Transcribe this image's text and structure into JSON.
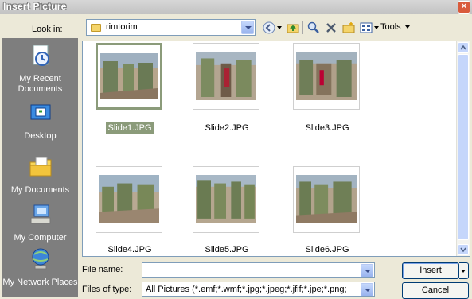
{
  "window": {
    "title": "Insert Picture",
    "close_glyph": "×"
  },
  "toolbar": {
    "look_in_label": "Look in:",
    "look_in_value": "rimtorim",
    "tools_label": "Tools"
  },
  "places": [
    {
      "label": "My Recent Documents",
      "icon": "recent-documents-icon"
    },
    {
      "label": "Desktop",
      "icon": "desktop-icon"
    },
    {
      "label": "My Documents",
      "icon": "my-documents-icon"
    },
    {
      "label": "My Computer",
      "icon": "my-computer-icon"
    },
    {
      "label": "My Network Places",
      "icon": "network-places-icon"
    }
  ],
  "files": [
    {
      "name": "Slide1.JPG",
      "selected": true
    },
    {
      "name": "Slide2.JPG",
      "selected": false
    },
    {
      "name": "Slide3.JPG",
      "selected": false
    },
    {
      "name": "Slide4.JPG",
      "selected": false
    },
    {
      "name": "Slide5.JPG",
      "selected": false
    },
    {
      "name": "Slide6.JPG",
      "selected": false
    }
  ],
  "form": {
    "file_name_label": "File name:",
    "file_name_value": "",
    "files_of_type_label": "Files of type:",
    "files_of_type_value": "All Pictures (*.emf;*.wmf;*.jpg;*.jpeg;*.jfif;*.jpe;*.png;"
  },
  "buttons": {
    "insert": "Insert",
    "cancel": "Cancel"
  },
  "colors": {
    "selection": "#8b9b7a",
    "places_bg": "#7e7e7e",
    "dialog_bg": "#ece9d8"
  }
}
